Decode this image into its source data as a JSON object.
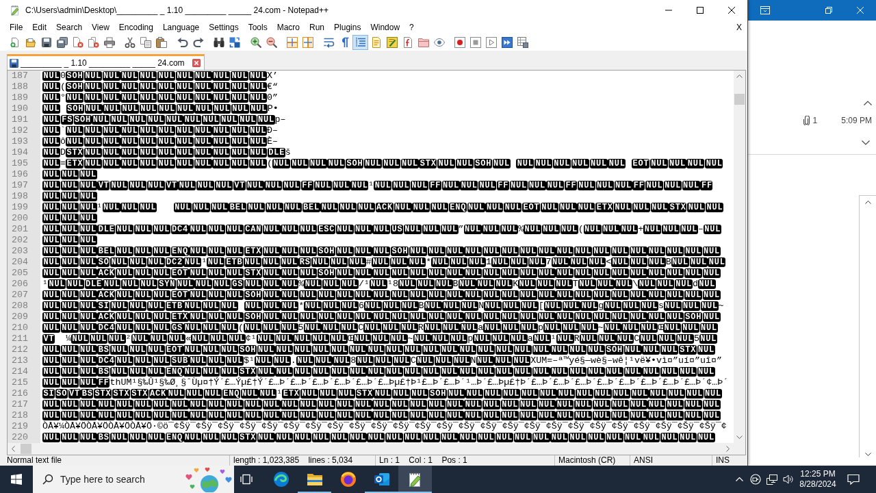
{
  "window": {
    "title": "C:\\Users\\admin\\Desktop\\_________ _ 1.10 _________ _____ 24.com - Notepad++"
  },
  "menu": {
    "items": [
      "File",
      "Edit",
      "Search",
      "View",
      "Encoding",
      "Language",
      "Settings",
      "Tools",
      "Macro",
      "Run",
      "Plugins",
      "Window",
      "?"
    ],
    "close_label": "X"
  },
  "toolbar": {
    "groups": [
      {
        "buttons": [
          {
            "kind": "new",
            "on": false
          },
          {
            "kind": "open",
            "on": false
          },
          {
            "kind": "save",
            "on": false
          },
          {
            "kind": "save_all",
            "on": false
          },
          {
            "kind": "close",
            "on": false
          },
          {
            "kind": "close_all",
            "on": false
          },
          {
            "kind": "print",
            "on": false
          }
        ]
      },
      {
        "buttons": [
          {
            "kind": "cut",
            "on": false
          },
          {
            "kind": "copy",
            "on": false
          },
          {
            "kind": "paste",
            "on": false
          }
        ]
      },
      {
        "buttons": [
          {
            "kind": "undo",
            "on": false
          },
          {
            "kind": "redo",
            "on": false
          }
        ]
      },
      {
        "buttons": [
          {
            "kind": "find",
            "on": false
          },
          {
            "kind": "replace",
            "on": false
          }
        ]
      },
      {
        "buttons": [
          {
            "kind": "zoom_in",
            "on": false
          },
          {
            "kind": "zoom_out",
            "on": false
          }
        ]
      },
      {
        "buttons": [
          {
            "kind": "sync_vertical",
            "on": false
          },
          {
            "kind": "sync_horizontal",
            "on": false
          }
        ]
      },
      {
        "buttons": [
          {
            "kind": "word_wrap",
            "on": false
          },
          {
            "kind": "all_chars",
            "on": false
          },
          {
            "kind": "indent_guide",
            "on": true
          },
          {
            "kind": "user_language",
            "on": false
          },
          {
            "kind": "document_map",
            "on": false
          },
          {
            "kind": "function_list",
            "on": false
          },
          {
            "kind": "folder_workspace",
            "on": false
          },
          {
            "kind": "monitoring",
            "on": false
          }
        ]
      },
      {
        "buttons": [
          {
            "kind": "record",
            "on": false
          },
          {
            "kind": "stop",
            "on": false
          },
          {
            "kind": "play",
            "on": false
          },
          {
            "kind": "play_multiple",
            "on": false
          },
          {
            "kind": "save_macro",
            "on": false
          }
        ]
      }
    ]
  },
  "tabs": [
    {
      "label": "_________ _ 1.10 _________ _____ 24.com",
      "selected": true
    }
  ],
  "editor": {
    "lines": [
      {
        "number": "187",
        "segments": [
          {
            "kind": "control",
            "text": "NUL"
          },
          {
            "kind": "text",
            "text": "0"
          },
          {
            "kind": "control",
            "text": "SOH NUL NUL NUL NUL NUL NUL NUL NUL NUL NUL"
          },
          {
            "kind": "text",
            "text": "X’"
          }
        ]
      },
      {
        "number": "188",
        "segments": [
          {
            "kind": "control",
            "text": "NUL"
          },
          {
            "kind": "text",
            "text": "("
          },
          {
            "kind": "control",
            "text": "SOH NUL NUL NUL NUL NUL NUL NUL NUL NUL NUL"
          },
          {
            "kind": "text",
            "text": "€“"
          }
        ]
      },
      {
        "number": "189",
        "segments": [
          {
            "kind": "control",
            "text": "NUL"
          },
          {
            "kind": "text",
            "text": "°"
          },
          {
            "kind": "control",
            "text": "NUL NUL NUL NUL NUL NUL NUL NUL NUL NUL NUL"
          },
          {
            "kind": "text",
            "text": "0”"
          }
        ]
      },
      {
        "number": "190",
        "segments": [
          {
            "kind": "control",
            "text": "NUL  SOH NUL NUL NUL NUL NUL NUL NUL NUL NUL NUL"
          },
          {
            "kind": "text",
            "text": "P•"
          }
        ]
      },
      {
        "number": "191",
        "segments": [
          {
            "kind": "control",
            "text": "NUL FS SOH NUL NUL NUL NUL NUL NUL NUL NUL NUL NUL"
          },
          {
            "kind": "text",
            "text": "p–"
          }
        ]
      },
      {
        "number": "192",
        "segments": [
          {
            "kind": "control",
            "text": "NUL"
          },
          {
            "kind": "text",
            "text": "`"
          },
          {
            "kind": "control",
            "text": "NUL NUL NUL NUL NUL NUL NUL NUL NUL NUL NUL"
          },
          {
            "kind": "text",
            "text": "Ð–"
          }
        ]
      },
      {
        "number": "193",
        "segments": [
          {
            "kind": "control",
            "text": "NUL"
          },
          {
            "kind": "text",
            "text": "ô"
          },
          {
            "kind": "control",
            "text": "NUL NUL NUL NUL NUL NUL NUL NUL NUL NUL NUL"
          },
          {
            "kind": "text",
            "text": "È–"
          }
        ]
      },
      {
        "number": "194",
        "segments": [
          {
            "kind": "control",
            "text": "NUL"
          },
          {
            "kind": "text",
            "text": "D"
          },
          {
            "kind": "control",
            "text": "STX NUL NUL NUL NUL NUL NUL NUL NUL NUL NUL DLE"
          },
          {
            "kind": "text",
            "text": "š"
          }
        ]
      },
      {
        "number": "195",
        "segments": [
          {
            "kind": "control",
            "text": "NUL"
          },
          {
            "kind": "text",
            "text": "="
          },
          {
            "kind": "control",
            "text": "ETX NUL NUL NUL NUL NUL NUL NUL NUL NUL NUL"
          },
          {
            "kind": "text",
            "text": "("
          },
          {
            "kind": "control",
            "text": "NUL NUL NUL NUL SOH NUL NUL NUL STX NUL NUL SOH NUL  NUL NUL NUL NUL NUL NUL  EOT NUL NUL NUL NUL"
          }
        ]
      },
      {
        "number": "196",
        "segments": [
          {
            "kind": "control",
            "text": "NUL NUL NUL"
          }
        ]
      },
      {
        "number": "197",
        "segments": [
          {
            "kind": "control",
            "text": "NUL NUL NUL VT NUL NUL NUL VT NUL NUL NUL VT NUL NUL NUL FF NUL NUL NUL"
          },
          {
            "kind": "text",
            "text": "¹"
          },
          {
            "kind": "control",
            "text": "NUL NUL NUL FF NUL NUL NUL FF NUL NUL NUL FF NUL NUL NUL FF NUL NUL NUL FF"
          }
        ]
      },
      {
        "number": "198",
        "segments": [
          {
            "kind": "control",
            "text": "NUL NUL NUL"
          }
        ]
      },
      {
        "number": "199",
        "segments": [
          {
            "kind": "control",
            "text": "NUL NUL NUL"
          },
          {
            "kind": "text",
            "text": "¹"
          },
          {
            "kind": "control",
            "text": "NUL NUL NUL    NUL NUL NUL BEL NUL NUL NUL BEL NUL NUL NUL ACK NUL NUL NUL ENQ NUL NUL NUL EOT NUL NUL NUL ETX NUL NUL NUL STX NUL NUL"
          }
        ]
      },
      {
        "number": "200",
        "segments": [
          {
            "kind": "control",
            "text": "NUL NUL NUL"
          }
        ]
      },
      {
        "number": "201",
        "segments": [
          {
            "kind": "control",
            "text": "NUL NUL NUL DLE NUL NUL NUL DC4 NUL NUL NUL CAN NUL NUL NUL ESC NUL NUL NUL US NUL NUL NUL"
          },
          {
            "kind": "text",
            "text": "”"
          },
          {
            "kind": "control",
            "text": "NUL NUL NUL"
          },
          {
            "kind": "text",
            "text": "%"
          },
          {
            "kind": "control",
            "text": "NUL NUL NUL"
          },
          {
            "kind": "text",
            "text": "("
          },
          {
            "kind": "control",
            "text": "NUL NUL NUL"
          },
          {
            "kind": "text",
            "text": "+"
          },
          {
            "kind": "control",
            "text": "NUL NUL NUL"
          },
          {
            "kind": "text",
            "text": "–"
          },
          {
            "kind": "control",
            "text": "NUL"
          }
        ]
      },
      {
        "number": "202",
        "segments": [
          {
            "kind": "control",
            "text": "NUL NUL NUL"
          }
        ]
      },
      {
        "number": "203",
        "segments": [
          {
            "kind": "control",
            "text": "NUL NUL NUL BEL NUL NUL NUL ENQ NUL NUL NUL ETX NUL NUL NUL SOH NUL NUL NUL SOH NUL NUL NUL NUL NUL NUL NUL NUL NUL NUL NUL NUL NUL NUL NUL NUL NUL"
          }
        ]
      },
      {
        "number": "204",
        "segments": [
          {
            "kind": "control",
            "text": "NUL NUL NUL SO NUL NUL NUL DC2 NUL"
          },
          {
            "kind": "text",
            "text": "¹"
          },
          {
            "kind": "control",
            "text": "NUL ETB NUL NUL NUL RS NUL NUL NUL"
          },
          {
            "kind": "text",
            "text": "#"
          },
          {
            "kind": "control",
            "text": "NUL NUL NUL"
          },
          {
            "kind": "text",
            "text": "*"
          },
          {
            "kind": "control",
            "text": "NUL NUL NUL"
          },
          {
            "kind": "text",
            "text": "1"
          },
          {
            "kind": "control",
            "text": "NUL NUL NUL"
          },
          {
            "kind": "text",
            "text": "7"
          },
          {
            "kind": "control",
            "text": "NUL NUL NUL"
          },
          {
            "kind": "text",
            "text": "<"
          },
          {
            "kind": "control",
            "text": "NUL NUL NUL"
          },
          {
            "kind": "text",
            "text": "B"
          },
          {
            "kind": "control",
            "text": "NUL NUL NUL"
          }
        ]
      },
      {
        "number": "205",
        "segments": [
          {
            "kind": "control",
            "text": "NUL NUL NUL ACK NUL NUL NUL EOT NUL NUL NUL STX NUL NUL NUL SOH NUL NUL NUL NUL NUL NUL NUL NUL NUL NUL NUL NUL NUL NUL NUL NUL NUL NUL NUL NUL NUL"
          }
        ]
      },
      {
        "number": "206",
        "segments": [
          {
            "kind": "text",
            "text": "¹"
          },
          {
            "kind": "control",
            "text": "NUL NUL DLE NUL NUL NUL SYN NUL NUL NUL GS NUL NUL NUL"
          },
          {
            "kind": "text",
            "text": "%"
          },
          {
            "kind": "control",
            "text": "NUL NUL NUL"
          },
          {
            "kind": "text",
            "text": "/¹"
          },
          {
            "kind": "control",
            "text": "NUL"
          },
          {
            "kind": "text",
            "text": "¹8"
          },
          {
            "kind": "control",
            "text": "NUL NUL NUL"
          },
          {
            "kind": "text",
            "text": "B"
          },
          {
            "kind": "control",
            "text": "NUL NUL NUL"
          },
          {
            "kind": "text",
            "text": "K"
          },
          {
            "kind": "control",
            "text": "NUL NUL NUL"
          },
          {
            "kind": "text",
            "text": "T"
          },
          {
            "kind": "control",
            "text": "NUL NUL NUL"
          },
          {
            "kind": "text",
            "text": "\\"
          },
          {
            "kind": "control",
            "text": "NUL NUL NUL"
          },
          {
            "kind": "text",
            "text": "d"
          },
          {
            "kind": "control",
            "text": "NUL"
          }
        ]
      },
      {
        "number": "207",
        "segments": [
          {
            "kind": "control",
            "text": "NUL NUL NUL ACK NUL NUL NUL EOT NUL NUL NUL SOH NUL NUL NUL NUL NUL NUL NUL NUL NUL NUL NUL NUL NUL NUL NUL NUL NUL NUL NUL NUL NUL NUL NUL NUL NUL"
          }
        ]
      },
      {
        "number": "208",
        "segments": [
          {
            "kind": "control",
            "text": "NUL NUL NUL SI NUL NUL NUL ETB NUL NUL NUL  NUL NUL NUL"
          },
          {
            "kind": "text",
            "text": "*"
          },
          {
            "kind": "control",
            "text": "NUL NUL NUL"
          },
          {
            "kind": "text",
            "text": "6"
          },
          {
            "kind": "control",
            "text": "NUL NUL NUL"
          },
          {
            "kind": "text",
            "text": "B"
          },
          {
            "kind": "control",
            "text": "NUL NUL NUL"
          },
          {
            "kind": "text",
            "text": "N"
          },
          {
            "kind": "control",
            "text": "NUL NUL NUL"
          },
          {
            "kind": "text",
            "text": "["
          },
          {
            "kind": "control",
            "text": "NUL NUL NUL"
          },
          {
            "kind": "text",
            "text": "g"
          },
          {
            "kind": "control",
            "text": "NUL NUL NUL"
          },
          {
            "kind": "text",
            "text": "s"
          },
          {
            "kind": "control",
            "text": "NUL NUL NUL"
          },
          {
            "kind": "text",
            "text": "~"
          }
        ]
      },
      {
        "number": "209",
        "segments": [
          {
            "kind": "control",
            "text": "NUL NUL NUL ACK NUL NUL NUL ETX NUL NUL NUL SOH NUL NUL NUL NUL NUL NUL NUL NUL NUL NUL NUL NUL NUL NUL NUL NUL NUL NUL NUL NUL NUL NUL NUL SOH NUL"
          }
        ]
      },
      {
        "number": "210",
        "segments": [
          {
            "kind": "control",
            "text": "NUL NUL NUL DC4 NUL NUL NUL GS NUL NUL NUL"
          },
          {
            "kind": "text",
            "text": "("
          },
          {
            "kind": "control",
            "text": "NUL NUL NUL"
          },
          {
            "kind": "text",
            "text": "5"
          },
          {
            "kind": "control",
            "text": "NUL NUL NUL"
          },
          {
            "kind": "text",
            "text": "C"
          },
          {
            "kind": "control",
            "text": "NUL NUL NUL"
          },
          {
            "kind": "text",
            "text": "R"
          },
          {
            "kind": "control",
            "text": "NUL NUL NUL"
          },
          {
            "kind": "text",
            "text": "a"
          },
          {
            "kind": "control",
            "text": "NUL NUL NUL"
          },
          {
            "kind": "text",
            "text": "p"
          },
          {
            "kind": "control",
            "text": "NUL NUL NUL"
          },
          {
            "kind": "text",
            "text": "~"
          },
          {
            "kind": "control",
            "text": "NUL NUL NUL"
          },
          {
            "kind": "text",
            "text": "Œ"
          },
          {
            "kind": "control",
            "text": "NUL NUL NUL"
          }
        ]
      },
      {
        "number": "211",
        "segments": [
          {
            "kind": "control",
            "text": "VT"
          },
          {
            "kind": "text",
            "text": "  ¼"
          },
          {
            "kind": "control",
            "text": "NUL NUL NUL"
          },
          {
            "kind": "text",
            "text": "²"
          },
          {
            "kind": "control",
            "text": "NUL NUL NUL"
          },
          {
            "kind": "text",
            "text": "«"
          },
          {
            "kind": "control",
            "text": "NUL NUL NUL"
          },
          {
            "kind": "text",
            "text": "¢¹"
          },
          {
            "kind": "control",
            "text": "NUL NUL NUL NUL NUL"
          },
          {
            "kind": "text",
            "text": "Œ"
          },
          {
            "kind": "control",
            "text": "NUL NUL NUL"
          },
          {
            "kind": "text",
            "text": "~"
          },
          {
            "kind": "control",
            "text": "NUL NUL NUL"
          },
          {
            "kind": "text",
            "text": "p"
          },
          {
            "kind": "control",
            "text": "NUL NUL NUL"
          },
          {
            "kind": "text",
            "text": "a"
          },
          {
            "kind": "control",
            "text": "NUL"
          },
          {
            "kind": "text",
            "text": "¹"
          },
          {
            "kind": "control",
            "text": "NUL"
          },
          {
            "kind": "text",
            "text": "R"
          },
          {
            "kind": "control",
            "text": "NUL NUL NUL"
          },
          {
            "kind": "text",
            "text": "C"
          },
          {
            "kind": "control",
            "text": "NUL NUL NUL"
          },
          {
            "kind": "text",
            "text": "5"
          },
          {
            "kind": "control",
            "text": "NUL"
          }
        ]
      },
      {
        "number": "212",
        "segments": [
          {
            "kind": "control",
            "text": "NUL NUL NUL BS NUL NUL NUL EOT NUL NUL NUL SOH NUL NUL NUL NUL NUL NUL NUL NUL NUL NUL NUL NUL NUL NUL NUL NUL NUL NUL NUL SOH NUL NUL NUL STX NUL"
          }
        ]
      },
      {
        "number": "213",
        "segments": [
          {
            "kind": "control",
            "text": "NUL NUL NUL DC4 NUL NUL NUL SUB NUL NUL NUL"
          },
          {
            "kind": "text",
            "text": "$¹"
          },
          {
            "kind": "control",
            "text": "NUL NUL"
          },
          {
            "kind": "text",
            "text": "."
          },
          {
            "kind": "control",
            "text": "NUL NUL NUL"
          },
          {
            "kind": "text",
            "text": "8"
          },
          {
            "kind": "control",
            "text": "NUL NUL NUL"
          },
          {
            "kind": "text",
            "text": "C"
          },
          {
            "kind": "control",
            "text": "NUL NUL NUL"
          },
          {
            "kind": "text",
            "text": "N"
          },
          {
            "kind": "control",
            "text": "NUL NUL NUL"
          },
          {
            "kind": "text",
            "text": "XUM=–ª™yé§—wè§–wê¦¹vë¥•vì¤”uí¤”uî¤”"
          }
        ]
      },
      {
        "number": "214",
        "segments": [
          {
            "kind": "control",
            "text": "NUL NUL NUL BS NUL NUL NUL ENQ NUL NUL NUL STX NUL NUL NUL NUL NUL NUL NUL NUL NUL NUL NUL NUL NUL NUL NUL NUL NUL NUL NUL NUL NUL NUL NUL NUL NUL"
          }
        ]
      },
      {
        "number": "215",
        "segments": [
          {
            "kind": "control",
            "text": "NUL NUL NUL FF"
          },
          {
            "kind": "text",
            "text": "thUM¹§‰Û¹§‰Ø¸§ˆÙµ¤†Ý´£…Ýµ£†Ý´£…Þ´£…Þ´£…Þ´£…Þ´£…Þ´£…Þµ£†Þ¹£…Þ´£…Þ´¹…Þ´£…Þµ£†Þ´£…Þ´£…Þ´£…Þ´£…Þ´£…Þ´£…Þ´£…Þ´£…Þ´¢…Þ´"
          }
        ]
      },
      {
        "number": "216",
        "segments": [
          {
            "kind": "control",
            "text": "SI SO VT BS STX STX STX ACK NUL NUL NUL ENQ NUL NUL"
          },
          {
            "kind": "text",
            "text": "¹"
          },
          {
            "kind": "control",
            "text": "ETX NUL NUL NUL STX NUL NUL NUL SOH NUL NUL NUL NUL NUL NUL NUL NUL NUL NUL NUL NUL NUL NUL NUL"
          }
        ]
      },
      {
        "number": "217",
        "segments": [
          {
            "kind": "control",
            "text": "NUL NUL NUL NUL NUL NUL NUL NUL NUL NUL NUL NUL NUL NUL NUL NUL NUL NUL NUL NUL NUL NUL NUL NUL NUL NUL NUL NUL NUL NUL NUL NUL NUL NUL NUL NUL NUL"
          }
        ]
      },
      {
        "number": "218",
        "segments": [
          {
            "kind": "control",
            "text": "NUL NUL NUL NUL NUL NUL NUL NUL NUL NUL NUL NUL NUL NUL NUL NUL NUL NUL NUL NUL NUL NUL NUL NUL NUL NUL NUL NUL NUL NUL NUL NUL NUL NUL NUL NUL NUL"
          }
        ]
      },
      {
        "number": "219",
        "segments": [
          {
            "kind": "text",
            "text": "ÒÅ¥¼ÒÅ¥ÖÒÅ¥ÖÒÅ¥ÖÒÅ¥Ö·©ö¯¢Šÿ¯¢Šÿ¯¢Šÿ¯¢Šÿ¯¢Šÿ¯¢Šÿ¯¢Šÿ¯¢Šÿ¯¢Šÿ¯¢Šÿ¯¢Šÿ¯¢Šÿ¯¢Šÿ¯¢Šÿ¯¢Šÿ¯¢Šÿ¯¢Šÿ¯¢Šÿ¯¢Šÿ¯¢Šÿ¯¢Šÿ¯¢Šÿ¯¢Šÿ¯¢Šÿ¯¢Šÿ¯¢"
          }
        ]
      },
      {
        "number": "220",
        "segments": [
          {
            "kind": "control",
            "text": "NUL NUL NUL BS NUL NUL NUL ENQ NUL NUL NUL STX NUL NUL NUL NUL NUL NUL NUL NUL NUL NUL NUL NUL NUL NUL NUL NUL NUL NUL NUL NUL NUL NUL NUL NUL NUL"
          }
        ]
      }
    ]
  },
  "status_bar": {
    "fields": [
      "Normal text file",
      "length : 1,023,385    lines : 5,034",
      "Ln : 1    Col : 1    Pos : 1",
      "Macintosh (CR)",
      "ANSI",
      "INS"
    ]
  },
  "background_window": {
    "attachment_count": "1",
    "time": "5:09 PM"
  },
  "taskbar": {
    "search": {
      "placeholder": "Type here to search"
    },
    "apps": [
      {
        "kind": "edge",
        "running": false,
        "selected": false
      },
      {
        "kind": "explorer",
        "running": true,
        "selected": false
      },
      {
        "kind": "firefox",
        "running": false,
        "selected": false
      },
      {
        "kind": "outlook",
        "running": true,
        "selected": false
      },
      {
        "kind": "notepad",
        "running": true,
        "selected": true
      }
    ],
    "clock": {
      "time": "12:25 PM",
      "date": "8/28/2024"
    }
  }
}
